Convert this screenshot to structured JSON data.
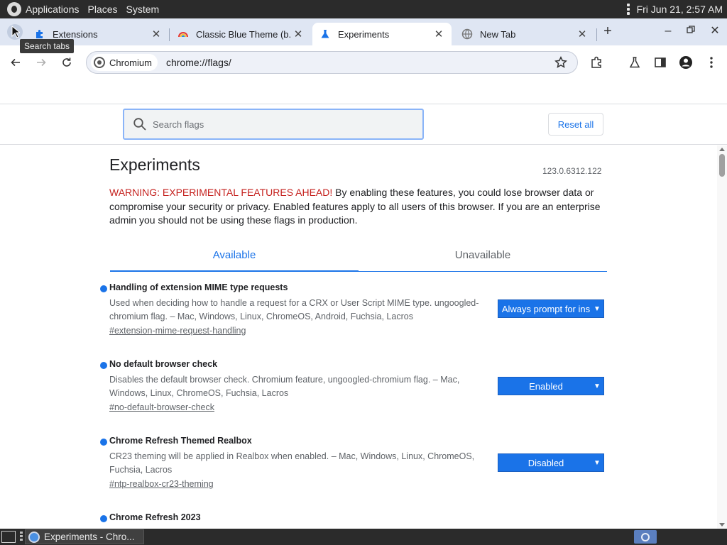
{
  "top_panel": {
    "applications": "Applications",
    "places": "Places",
    "system": "System",
    "clock": "Fri Jun 21,  2:57 AM"
  },
  "tabs": [
    {
      "title": "Extensions",
      "icon": "puzzle-icon",
      "active": false
    },
    {
      "title": "Classic Blue Theme (b...",
      "icon": "rainbow-icon",
      "active": false
    },
    {
      "title": "Experiments",
      "icon": "flask-icon",
      "active": true
    },
    {
      "title": "New Tab",
      "icon": "globe-icon",
      "active": false
    }
  ],
  "tooltip": "Search tabs",
  "toolbar": {
    "chip_label": "Chromium",
    "url": "chrome://flags/"
  },
  "flags_header": {
    "search_placeholder": "Search flags",
    "reset_label": "Reset all"
  },
  "page": {
    "title": "Experiments",
    "version": "123.0.6312.122",
    "warning_red": "WARNING: EXPERIMENTAL FEATURES AHEAD!",
    "warning_rest": " By enabling these features, you could lose browser data or compromise your security or privacy. Enabled features apply to all users of this browser. If you are an enterprise admin you should not be using these flags in production.",
    "tab_available": "Available",
    "tab_unavailable": "Unavailable"
  },
  "flags": [
    {
      "name": "Handling of extension MIME type requests",
      "description": "Used when deciding how to handle a request for a CRX or User Script MIME type. ungoogled-chromium flag. – Mac, Windows, Linux, ChromeOS, Android, Fuchsia, Lacros",
      "permalink": "#extension-mime-request-handling",
      "value": "Always prompt for ins"
    },
    {
      "name": "No default browser check",
      "description": "Disables the default browser check. Chromium feature, ungoogled-chromium flag. – Mac, Windows, Linux, ChromeOS, Fuchsia, Lacros",
      "permalink": "#no-default-browser-check",
      "value": "Enabled"
    },
    {
      "name": "Chrome Refresh Themed Realbox",
      "description": "CR23 theming will be applied in Realbox when enabled. – Mac, Windows, Linux, ChromeOS, Fuchsia, Lacros",
      "permalink": "#ntp-realbox-cr23-theming",
      "value": "Disabled"
    },
    {
      "name": "Chrome Refresh 2023",
      "description": "",
      "permalink": "",
      "value": ""
    }
  ],
  "taskbar": {
    "task_title": "Experiments - Chro..."
  },
  "colors": {
    "accent": "#1a73e8",
    "warning": "#c5221f",
    "tabstrip": "#dfe6f3"
  }
}
